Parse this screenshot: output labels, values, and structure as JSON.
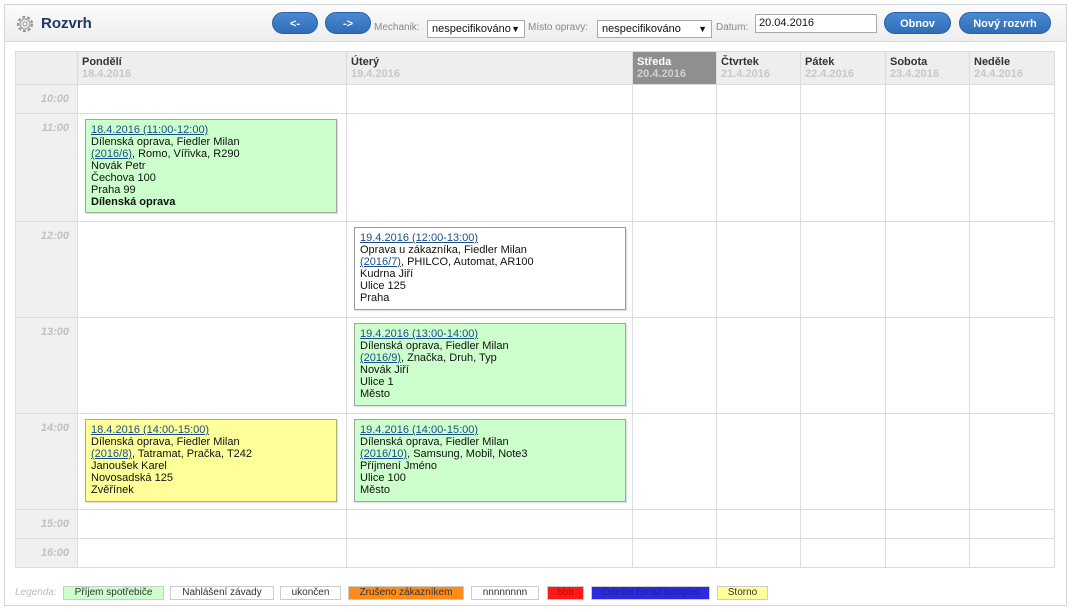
{
  "header": {
    "title": "Rozvrh",
    "prev_label": "<-",
    "next_label": "->",
    "mechanic_label": "Mechanik:",
    "mechanic_value": "nespecifikováno",
    "place_label": "Místo opravy:",
    "place_value": "nespecifikováno",
    "date_label": "Datum:",
    "date_value": "20.04.2016",
    "refresh_label": "Obnov",
    "new_label": "Nový rozvrh"
  },
  "days": [
    {
      "name": "Pondělí",
      "date": "18.4.2016"
    },
    {
      "name": "Úterý",
      "date": "19.4.2016"
    },
    {
      "name": "Středa",
      "date": "20.4.2016"
    },
    {
      "name": "Čtvrtek",
      "date": "21.4.2016"
    },
    {
      "name": "Pátek",
      "date": "22.4.2016"
    },
    {
      "name": "Sobota",
      "date": "23.4.2016"
    },
    {
      "name": "Neděle",
      "date": "24.4.2016"
    }
  ],
  "hours": [
    "10:00",
    "11:00",
    "12:00",
    "13:00",
    "14:00",
    "15:00",
    "16:00"
  ],
  "events": {
    "mon_11": {
      "time": "18.4.2016 (11:00-12:00)",
      "line1": "Dílenská oprava, Fiedler Milan",
      "order": "(2016/6)",
      "device": ", Romo, Vířivka, R290",
      "customer": "Novák Petr",
      "street": "Čechova 100",
      "city": "Praha 99",
      "type": "Dílenská oprava",
      "color": "#ccffcc"
    },
    "tue_12": {
      "time": "19.4.2016 (12:00-13:00)",
      "line1": "Oprava u zákazníka, Fiedler Milan",
      "order": "(2016/7)",
      "device": ", PHILCO, Automat, AR100",
      "customer": "Kudrna Jiří",
      "street": "Ulice 125",
      "city": "Praha",
      "color": "#ffffff"
    },
    "tue_13": {
      "time": "19.4.2016 (13:00-14:00)",
      "line1": "Dílenská oprava, Fiedler Milan",
      "order": "(2016/9)",
      "device": ", Značka, Druh, Typ",
      "customer": "Novák Jiří",
      "street": "Ulice 1",
      "city": "Město",
      "color": "#ccffcc"
    },
    "mon_14": {
      "time": "18.4.2016 (14:00-15:00)",
      "line1": "Dílenská oprava, Fiedler Milan",
      "order": "(2016/8)",
      "device": ", Tatramat, Pračka, T242",
      "customer": "Janoušek Karel",
      "street": "Novosadská 125",
      "city": "Zvěřínek",
      "color": "#ffff99"
    },
    "tue_14": {
      "time": "19.4.2016 (14:00-15:00)",
      "line1": "Dílenská oprava, Fiedler Milan",
      "order": "(2016/10)",
      "device": ", Samsung, Mobil, Note3",
      "customer": "Příjmení Jméno",
      "street": "Ulice 100",
      "city": "Město",
      "color": "#ccffcc"
    }
  },
  "legend": {
    "label": "Legenda:",
    "items": [
      {
        "text": "Příjem spotřebiče",
        "color": "#ccffcc",
        "fg": "#333333"
      },
      {
        "text": "Nahlášení závady",
        "color": "#ffffff",
        "fg": "#333333"
      },
      {
        "text": "ukončen",
        "color": "#ffffff",
        "fg": "#333333"
      },
      {
        "text": "Zrušeno zákazníkem",
        "color": "#ff8c1a",
        "fg": "#333333"
      },
      {
        "text": "nnnnnnnn",
        "color": "#ffffff",
        "fg": "#333333"
      },
      {
        "text": "bbb",
        "color": "#ff1a1a",
        "fg": "#cc0000"
      },
      {
        "text": "Odešle Email komplet",
        "color": "#2b2bdd",
        "fg": "#1f1fa0"
      },
      {
        "text": "Storno",
        "color": "#ffff99",
        "fg": "#333333"
      }
    ]
  }
}
